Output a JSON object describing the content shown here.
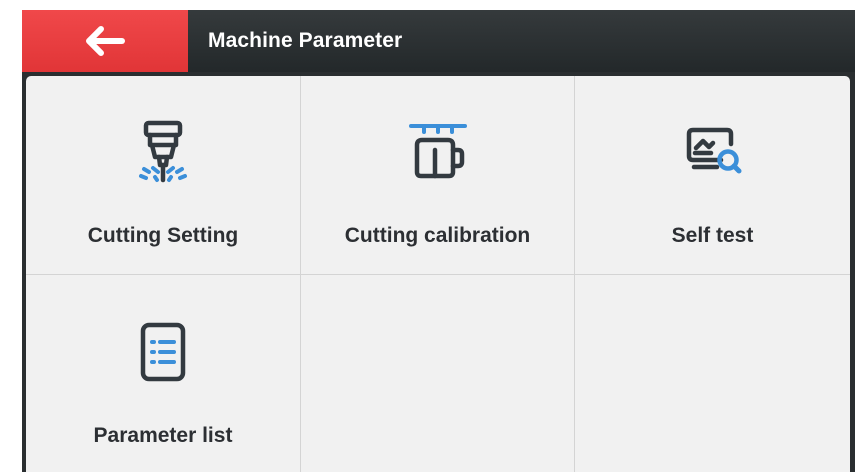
{
  "header": {
    "title": "Machine Parameter",
    "back_icon": "arrow-left-icon"
  },
  "menu": {
    "items": [
      {
        "label": "Cutting Setting",
        "icon": "cutting-head-icon"
      },
      {
        "label": "Cutting calibration",
        "icon": "calibration-icon"
      },
      {
        "label": "Self test",
        "icon": "monitor-search-icon"
      },
      {
        "label": "Parameter list",
        "icon": "list-document-icon"
      }
    ]
  },
  "colors": {
    "accent_red": "#e13537",
    "header_dark": "#2a2e30",
    "panel_bg": "#f1f1f1",
    "icon_dark": "#333a40",
    "icon_blue": "#3b8fd9",
    "text_dark": "#2c2f33"
  }
}
